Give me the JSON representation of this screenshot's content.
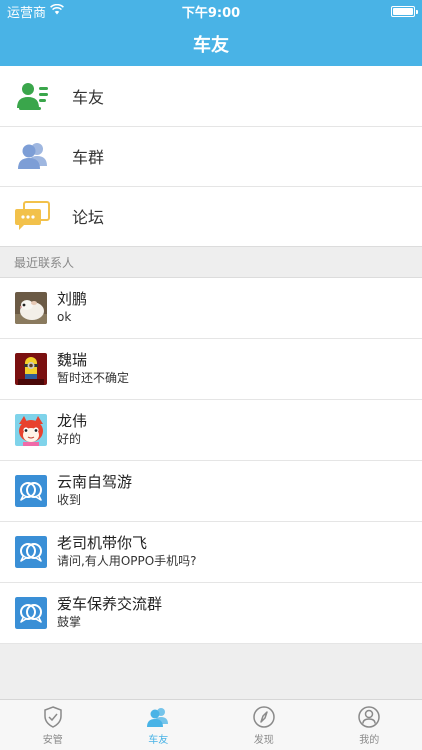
{
  "status_bar": {
    "carrier": "运营商",
    "time": "下午9:00",
    "battery_level": 1.0
  },
  "header": {
    "title": "车友"
  },
  "menu": [
    {
      "label": "车友",
      "icon": "contact-card-icon",
      "color": "#3aa64b"
    },
    {
      "label": "车群",
      "icon": "group-icon",
      "color": "#7d9ed6"
    },
    {
      "label": "论坛",
      "icon": "forum-chat-icon",
      "color": "#f2c14b"
    }
  ],
  "recent_header": "最近联系人",
  "contacts": [
    {
      "name": "刘鹏",
      "message": "ok",
      "avatar": "hamster-photo"
    },
    {
      "name": "魏瑞",
      "message": "暂时还不确定",
      "avatar": "minion-photo"
    },
    {
      "name": "龙伟",
      "message": "好的",
      "avatar": "cartoon-fox-photo"
    },
    {
      "name": "云南自驾游",
      "message": "收到",
      "avatar": "group-chat-icon"
    },
    {
      "name": "老司机带你飞",
      "message": "请问,有人用OPPO手机吗?",
      "avatar": "group-chat-icon"
    },
    {
      "name": "爱车保养交流群",
      "message": "鼓掌",
      "avatar": "group-chat-icon"
    }
  ],
  "tabs": [
    {
      "label": "安管",
      "icon": "shield-check-icon",
      "active": false
    },
    {
      "label": "车友",
      "icon": "friends-icon",
      "active": true
    },
    {
      "label": "发现",
      "icon": "compass-icon",
      "active": false
    },
    {
      "label": "我的",
      "icon": "profile-icon",
      "active": false
    }
  ],
  "colors": {
    "accent": "#49b3e6",
    "group_avatar": "#3a8fd6"
  }
}
